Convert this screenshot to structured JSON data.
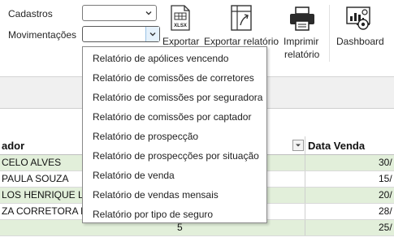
{
  "ribbon": {
    "cadastros_label": "Cadastros",
    "movimentacoes_label": "Movimentações",
    "export_btn_label": "Exportar",
    "export_report_label": "Exportar relatório",
    "print_report_line1": "Imprimir",
    "print_report_line2": "relatório",
    "dashboard_label": "Dashboard",
    "xlsx_icon_text": "XLSX"
  },
  "dropdown": {
    "items": [
      "Relatório de apólices vencendo",
      "Relatório de comissões de corretores",
      "Relatório de comissões por seguradora",
      "Relatório de comissões por captador",
      "Relatório de prospecção",
      "Relatório de prospecções por situação",
      "Relatório de venda",
      "Relatório de vendas mensais",
      "Relatório por tipo de seguro"
    ]
  },
  "table": {
    "headers": {
      "col1": "ador",
      "col2": "Data Venda"
    },
    "rows": [
      {
        "name": "CELO ALVES",
        "date": "30/"
      },
      {
        "name": "PAULA SOUZA",
        "date": "15/"
      },
      {
        "name": "LOS HENRIQUE LIN",
        "date": "20/"
      },
      {
        "name": "ZA CORRETORA D",
        "date": "28/"
      },
      {
        "name": "5",
        "date": "25/"
      }
    ]
  },
  "colors": {
    "row_green": "#e2efda",
    "ribbon_bg": "#ffffff",
    "grey_band": "#f0f0f0"
  }
}
